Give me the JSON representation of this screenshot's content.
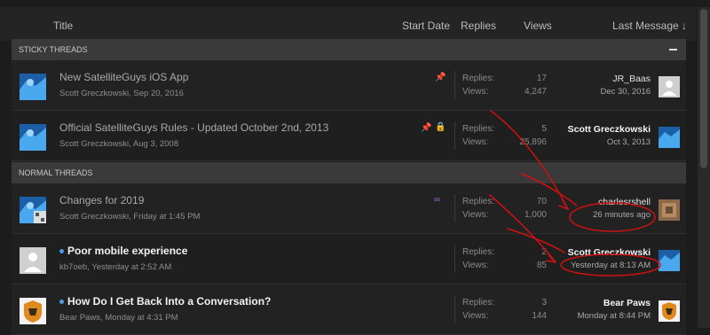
{
  "header": {
    "title": "Title",
    "start_date": "Start Date",
    "replies": "Replies",
    "views": "Views",
    "last_message": "Last Message ↓"
  },
  "sections": {
    "sticky": "STICKY THREADS",
    "normal": "NORMAL THREADS"
  },
  "stat_labels": {
    "replies": "Replies:",
    "views": "Views:"
  },
  "threads": [
    {
      "title": "New SatelliteGuys iOS App",
      "meta": "Scott Greczkowski, Sep 20, 2016",
      "replies": "17",
      "views": "4,247",
      "last_user": "JR_Baas",
      "last_time": "Dec 30, 2016",
      "icons": [
        "pin-icon"
      ]
    },
    {
      "title": "Official SatelliteGuys Rules - Updated October 2nd, 2013",
      "meta": "Scott Greczkowski, Aug 3, 2008",
      "replies": "5",
      "views": "25,896",
      "last_user": "Scott Greczkowski",
      "last_time": "Oct 3, 2013",
      "icons": [
        "pin-icon",
        "lock-icon"
      ]
    },
    {
      "title": "Changes for 2019",
      "meta": "Scott Greczkowski, Friday at 1:45 PM",
      "replies": "70",
      "views": "1,000",
      "last_user": "charlesrshell",
      "last_time": "26 minutes ago",
      "icons": [
        "watch-icon"
      ]
    },
    {
      "title": "Poor mobile experience",
      "meta": "kb7oeb, Yesterday at 2:52 AM",
      "replies": "2",
      "views": "85",
      "last_user": "Scott Greczkowski",
      "last_time": "Yesterday at 8:13 AM",
      "unread": true
    },
    {
      "title": "How Do I Get Back Into a Conversation?",
      "meta": "Bear Paws, Monday at 4:31 PM",
      "replies": "3",
      "views": "144",
      "last_user": "Bear Paws",
      "last_time": "Monday at 8:44 PM",
      "unread": true
    }
  ],
  "colors": {
    "annotation": "#d01010",
    "unread_dot": "#4a9de8",
    "pin": "#e23b3b",
    "lock": "#e8c21a",
    "watch": "#9b6ad8"
  }
}
